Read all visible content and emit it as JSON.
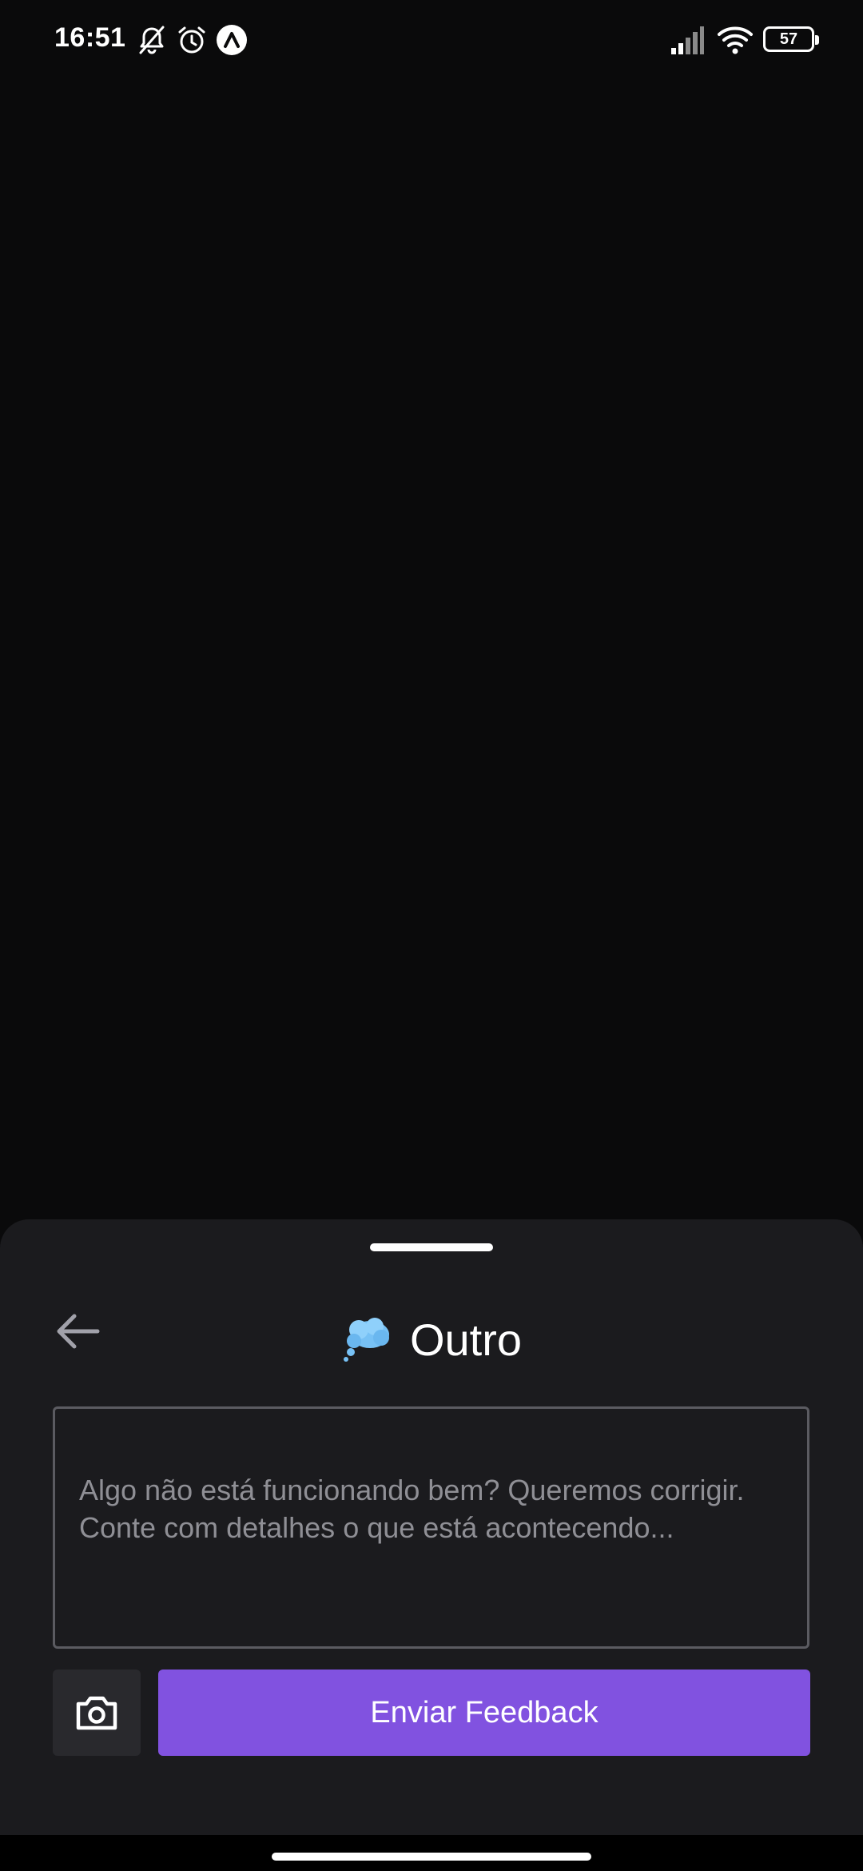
{
  "status_bar": {
    "time": "16:51",
    "battery": "57",
    "icons": [
      "bell-off-icon",
      "alarm-icon",
      "app-a-icon",
      "signal-icon",
      "wifi-icon",
      "battery-icon"
    ]
  },
  "sheet": {
    "title": "Outro",
    "title_icon": "thought-bubble-icon",
    "back_icon": "arrow-left-icon",
    "textarea": {
      "value": "",
      "placeholder": "Algo não está funcionando bem? Queremos corrigir. Conte com detalhes o que está acontecendo..."
    },
    "screenshot_icon": "camera-icon",
    "submit_label": "Enviar Feedback"
  },
  "colors": {
    "background": "#0a0a0b",
    "sheet": "#1b1b1e",
    "accent": "#8152e0",
    "border": "#5b5b61"
  }
}
